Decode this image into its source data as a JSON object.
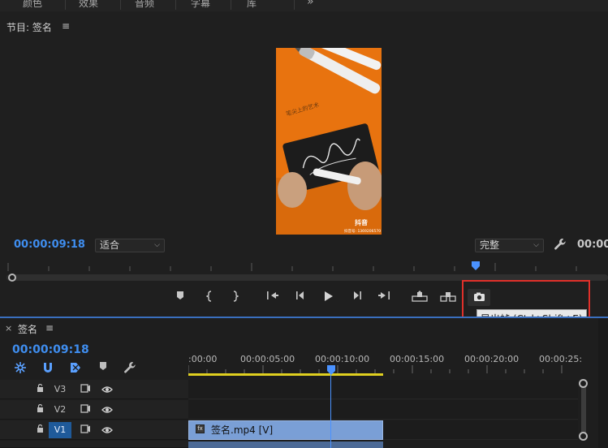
{
  "top_tabs": [
    "颜色",
    "效果",
    "音频",
    "字幕",
    "库"
  ],
  "top_more_glyph": "»",
  "program_monitor": {
    "title": "节目: 签名",
    "menu_glyph": "≡",
    "timecode": "00:00:09:18",
    "fit_option": "适合",
    "quality_option": "完整",
    "timecode_right": "00:00",
    "video_overlay": {
      "calligraphy": "笔尖上的艺术",
      "logo": "抖音",
      "account": "抖音号: 1369206570"
    }
  },
  "transport": {
    "tooltip": "导出帧 (Ctrl+Shift+E)"
  },
  "timeline": {
    "close_glyph": "×",
    "title": "签名",
    "menu_glyph": "≡",
    "timecode": "00:00:09:18",
    "ruler_labels": [
      ":00:00",
      "00:00:05:00",
      "00:00:10:00",
      "00:00:15:00",
      "00:00:20:00",
      "00:00:25:"
    ],
    "tracks": [
      {
        "name": "V3",
        "active": false
      },
      {
        "name": "V2",
        "active": false
      },
      {
        "name": "V1",
        "active": true
      }
    ],
    "clip_label": "签名.mp4 [V]",
    "clip_fx": "fx"
  },
  "colors": {
    "accent_blue": "#3f8ef0",
    "highlight_red": "#e0302a",
    "video_orange": "#e8730f",
    "work_area_yellow": "#e0d020",
    "clip_blue": "#7a9fd6"
  }
}
